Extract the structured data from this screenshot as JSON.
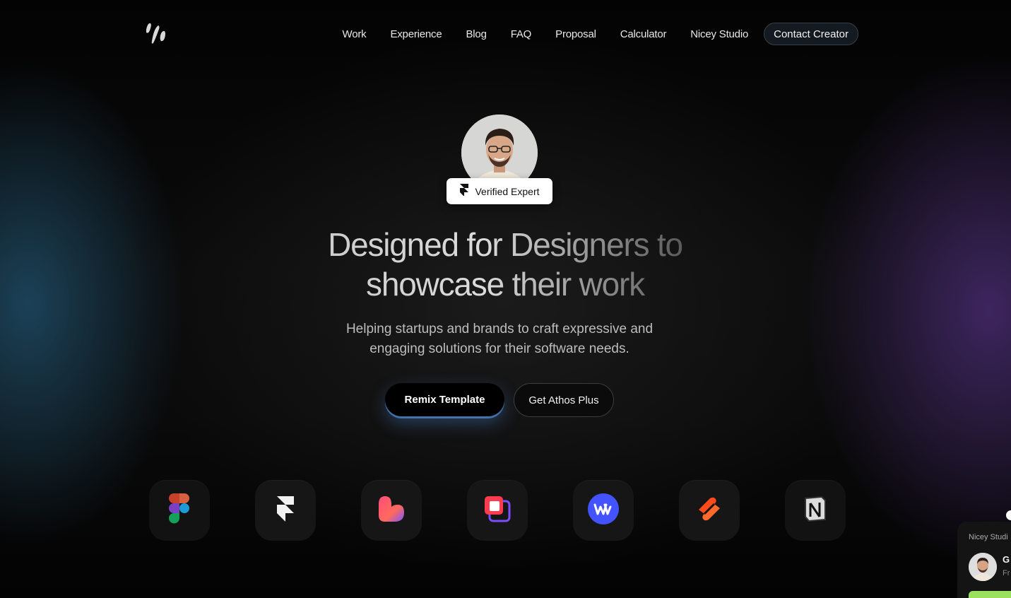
{
  "nav": {
    "logo_icon": "athos-logo-icon",
    "links": [
      "Work",
      "Experience",
      "Blog",
      "FAQ",
      "Proposal",
      "Calculator",
      "Nicey Studio"
    ],
    "cta": "Contact Creator"
  },
  "hero": {
    "badge": "Verified Expert",
    "badge_icon": "framer-icon",
    "title_line1": "Designed for Designers to",
    "title_line2": "showcase their work",
    "subtitle_line1": "Helping startups and brands to craft expressive and",
    "subtitle_line2": "engaging solutions for their software needs.",
    "primary_button": "Remix Template",
    "secondary_button": "Get Athos Plus"
  },
  "tools": [
    "figma-icon",
    "framer-icon",
    "clay-icon",
    "layers-icon",
    "webflow-icon",
    "zapier-icon",
    "notion-icon"
  ],
  "chat": {
    "studio": "Nicey Studi",
    "name": "G",
    "sub": "Fr"
  },
  "colors": {
    "background": "#050505",
    "accent_blue": "#4a8fd8",
    "accent_purple": "#6a3fa0",
    "chat_green": "#9be15d"
  }
}
